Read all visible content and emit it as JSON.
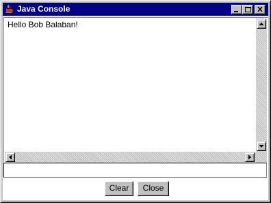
{
  "window": {
    "title": "Java Console",
    "icon": "java-cup-icon",
    "controls": {
      "minimize": "minimize-icon",
      "maximize": "maximize-icon",
      "close": "close-icon"
    }
  },
  "console": {
    "output": "Hello Bob Balaban!",
    "input_value": ""
  },
  "buttons": {
    "clear_label": "Clear",
    "close_label": "Close"
  },
  "colors": {
    "titlebar": "#000080",
    "face": "#c0c0c0"
  }
}
